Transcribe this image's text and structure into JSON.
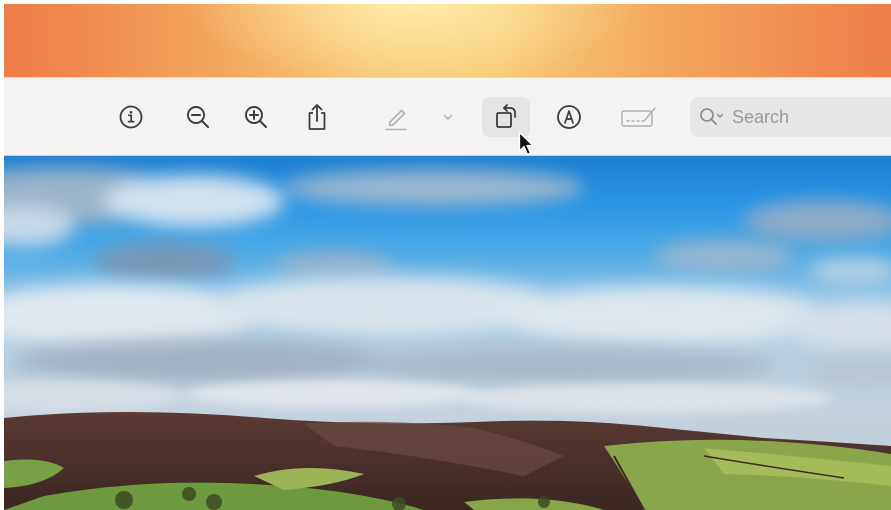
{
  "toolbar": {
    "buttons": [
      {
        "icon": "info-icon"
      },
      {
        "icon": "zoom-out-icon"
      },
      {
        "icon": "zoom-in-icon"
      },
      {
        "icon": "share-icon"
      },
      {
        "icon": "markup-pen-icon"
      },
      {
        "icon": "chevron-down-icon"
      },
      {
        "icon": "rotate-icon",
        "state": "hovered"
      },
      {
        "icon": "markup-circle-icon"
      },
      {
        "icon": "signature-icon"
      }
    ],
    "search": {
      "placeholder": "Search",
      "value": ""
    }
  },
  "photo": {
    "subject": "landscape-photo"
  },
  "colors": {
    "toolbar_bg": "#f3f3f3",
    "icon": "#3c3c3c",
    "icon_muted": "#b0b0b0",
    "wallpaper_orange": "#ee7c48",
    "sky_blue": "#2b95e4"
  }
}
